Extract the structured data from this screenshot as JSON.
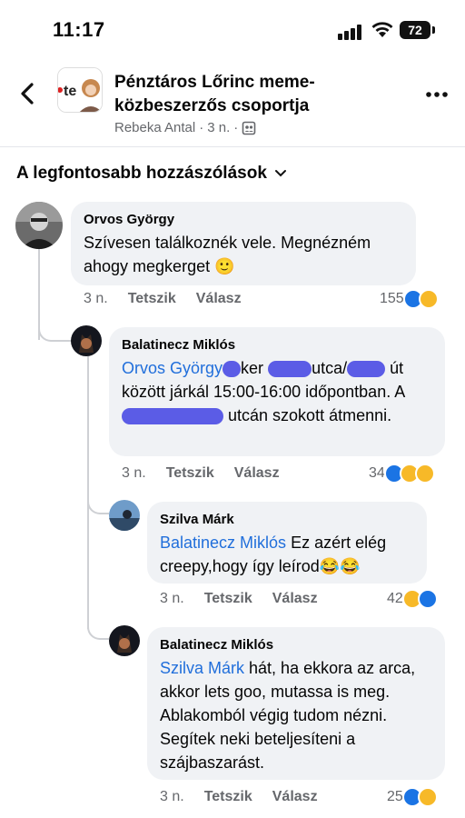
{
  "status_bar": {
    "time": "11:17",
    "battery": "72"
  },
  "header": {
    "title": "Pénztáros Lőrinc meme-közbeszerzős csoportja",
    "author": "Rebeka Antal",
    "age": "3 n.",
    "dot": "·"
  },
  "section": {
    "title": "A legfontosabb hozzászólások"
  },
  "comments": [
    {
      "author": "Orvos György",
      "text": "Szívesen találkoznék vele. Megnézném ahogy megkerget 🙂",
      "ago": "3 n.",
      "like": "Tetszik",
      "reply": "Válasz",
      "count": "155"
    },
    {
      "author": "Balatinecz Miklós",
      "mention": "Orvos György",
      "t1": "ker",
      "t2": "utca/",
      "t3": "út",
      "t4": "között járkál 15:00-16:00 időpontban. A",
      "t5": "utcán szokott átmenni.",
      "ago": "3 n.",
      "like": "Tetszik",
      "reply": "Válasz",
      "count": "34"
    },
    {
      "author": "Szilva Márk",
      "mention": "Balatinecz Miklós",
      "text": "Ez azért elég creepy,hogy így leírod😂😂",
      "ago": "3 n.",
      "like": "Tetszik",
      "reply": "Válasz",
      "count": "42"
    },
    {
      "author": "Balatinecz Miklós",
      "mention": "Szilva Márk",
      "text": "hát, ha ekkora az arca, akkor lets goo, mutassa is meg. Ablakomból végig tudom nézni. Segítek neki beteljesíteni a szájbaszarást.",
      "ago": "3 n.",
      "like": "Tetszik",
      "reply": "Válasz",
      "count": "25"
    }
  ]
}
